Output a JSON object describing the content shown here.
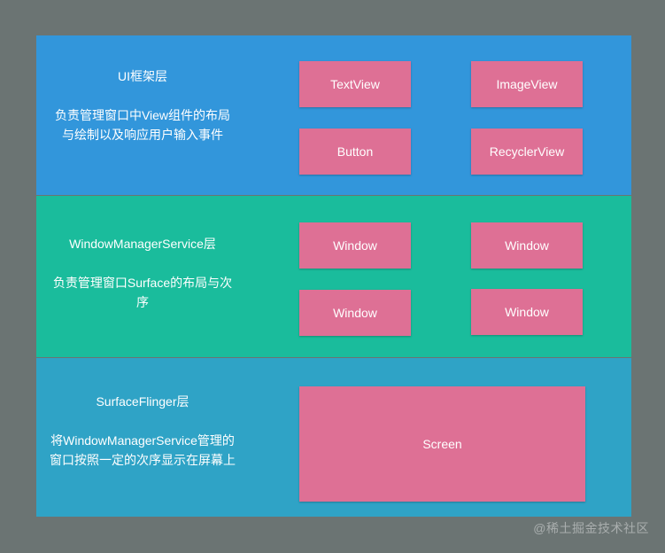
{
  "layers": {
    "ui": {
      "title": "UI框架层",
      "description": "负责管理窗口中View组件的布局与绘制以及响应用户输入事件",
      "boxes": [
        "TextView",
        "ImageView",
        "Button",
        "RecyclerView"
      ]
    },
    "wms": {
      "title": "WindowManagerService层",
      "description": "负责管理窗口Surface的布局与次序",
      "boxes": [
        "Window",
        "Window",
        "Window",
        "Window"
      ]
    },
    "sf": {
      "title": "SurfaceFlinger层",
      "description": "将WindowManagerService管理的窗口按照一定的次序显示在屏幕上",
      "boxes": [
        "Screen"
      ]
    }
  },
  "watermark": "@稀土掘金技术社区",
  "colors": {
    "background": "#6b7473",
    "ui_layer": "#3296db",
    "wms_layer": "#1abc9c",
    "sf_layer": "#2fa3c6",
    "box": "#de7095",
    "text": "#ffffff"
  }
}
